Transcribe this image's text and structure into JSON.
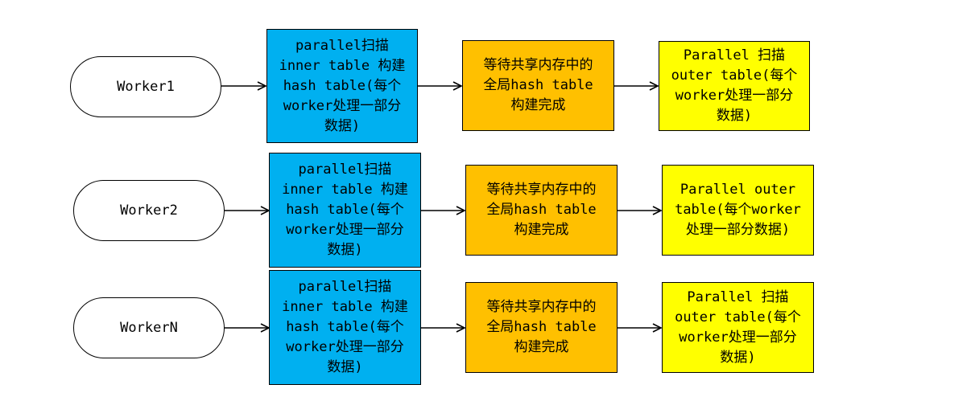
{
  "rows": [
    {
      "worker": "Worker1",
      "scan_inner": "parallel扫描\ninner table 构建\nhash table(每个\nworker处理一部分\n数据)",
      "wait": "等待共享内存中的\n全局hash table\n构建完成",
      "scan_outer": "Parallel 扫描\nouter table(每个\nworker处理一部分\n数据)"
    },
    {
      "worker": "Worker2",
      "scan_inner": "parallel扫描\ninner table 构建\nhash table(每个\nworker处理一部分\n数据)",
      "wait": "等待共享内存中的\n全局hash table\n构建完成",
      "scan_outer": "Parallel outer\ntable(每个worker\n处理一部分数据)"
    },
    {
      "worker": "WorkerN",
      "scan_inner": "parallel扫描\ninner table 构建\nhash table(每个\nworker处理一部分\n数据)",
      "wait": "等待共享内存中的\n全局hash table\n构建完成",
      "scan_outer": "Parallel 扫描\nouter table(每个\nworker处理一部分\n数据)"
    }
  ],
  "colors": {
    "worker_fill": "#ffffff",
    "scan_inner_fill": "#00b0f0",
    "wait_fill": "#ffc000",
    "scan_outer_fill": "#ffff00",
    "stroke": "#000000"
  }
}
